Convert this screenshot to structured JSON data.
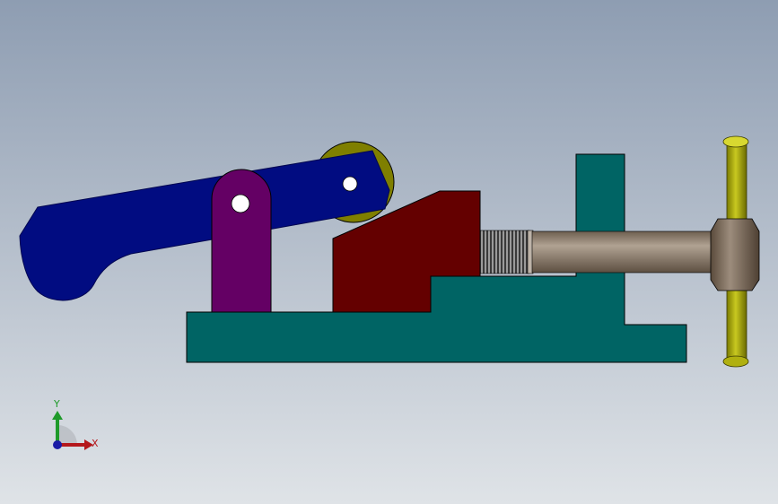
{
  "viewport": {
    "background_top": "#8e9db2",
    "background_bottom": "#dfe3e7"
  },
  "model": {
    "colors": {
      "lever": "#010c81",
      "lever_edge": "#000650",
      "roller": "#7f7f00",
      "pivot_link": "#640064",
      "base": "#006464",
      "jaw": "#640000",
      "screw_thread": "#2a2a2a",
      "screw_shaft": "#8b7b6b",
      "knob": "#7a6a5a",
      "tommy_bar": "#a6a600",
      "outline": "#000000"
    }
  },
  "triad": {
    "x_label": "X",
    "y_label": "Y",
    "x_color": "#b4171b",
    "y_color": "#1e9a2a",
    "z_color": "#1a1aa6"
  }
}
